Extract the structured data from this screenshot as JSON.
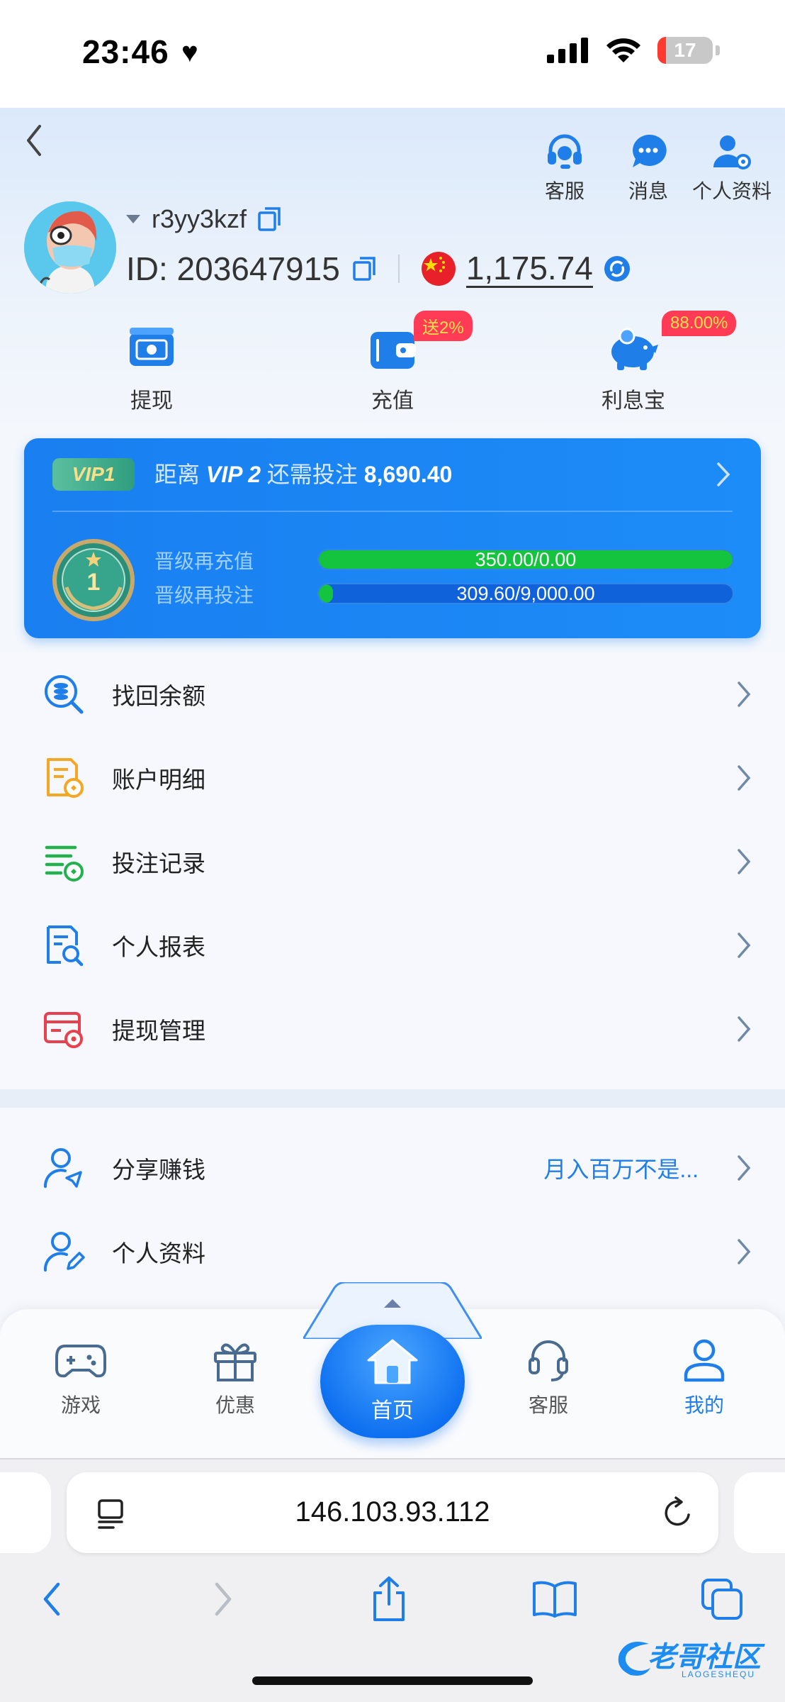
{
  "status_bar": {
    "time": "23:46",
    "battery": "17"
  },
  "header": {
    "actions": [
      {
        "label": "客服",
        "icon": "headset-icon"
      },
      {
        "label": "消息",
        "icon": "message-icon"
      },
      {
        "label": "个人资料",
        "icon": "user-settings-icon"
      }
    ],
    "username": "r3yy3kzf",
    "user_id": "ID: 203647915",
    "balance": "1,175.74",
    "currency_icon": "china-flag-icon"
  },
  "quick_actions": [
    {
      "label": "提现",
      "icon": "withdraw-icon",
      "badge": ""
    },
    {
      "label": "充值",
      "icon": "wallet-icon",
      "badge": "送2%"
    },
    {
      "label": "利息宝",
      "icon": "piggy-bank-icon",
      "badge": "88.00%"
    }
  ],
  "vip": {
    "current_level": "VIP1",
    "medal_level": "1",
    "prefix": "距离",
    "next_level": "VIP 2",
    "middle": "还需投注",
    "remaining": "8,690.40",
    "recharge_label": "晋级再充值",
    "recharge_progress": "350.00/0.00",
    "recharge_fraction": 1.0,
    "bet_label": "晋级再投注",
    "bet_progress": "309.60/9,000.00",
    "bet_fraction": 0.034
  },
  "menu_main": [
    {
      "label": "找回余额",
      "icon": "search-coins-icon"
    },
    {
      "label": "账户明细",
      "icon": "account-detail-icon"
    },
    {
      "label": "投注记录",
      "icon": "bet-record-icon"
    },
    {
      "label": "个人报表",
      "icon": "report-icon"
    },
    {
      "label": "提现管理",
      "icon": "withdraw-manage-icon"
    }
  ],
  "menu_secondary": [
    {
      "label": "分享赚钱",
      "icon": "share-user-icon",
      "extra": "月入百万不是..."
    },
    {
      "label": "个人资料",
      "icon": "edit-user-icon",
      "extra": ""
    }
  ],
  "tabbar": {
    "tabs": [
      {
        "label": "游戏",
        "icon": "gamepad-icon"
      },
      {
        "label": "优惠",
        "icon": "gift-icon"
      },
      {
        "label": "首页",
        "icon": "home-icon"
      },
      {
        "label": "客服",
        "icon": "headset-icon"
      },
      {
        "label": "我的",
        "icon": "user-icon"
      }
    ],
    "active": "我的"
  },
  "browser": {
    "url": "146.103.93.112"
  },
  "watermark": {
    "text": "老哥社区",
    "sub": "LAOGESHEQU"
  },
  "colors": {
    "accent": "#1f7ee8",
    "vip_card": "#1a7ff0",
    "progress": "#14c43e",
    "badge": "#ff3b56"
  }
}
